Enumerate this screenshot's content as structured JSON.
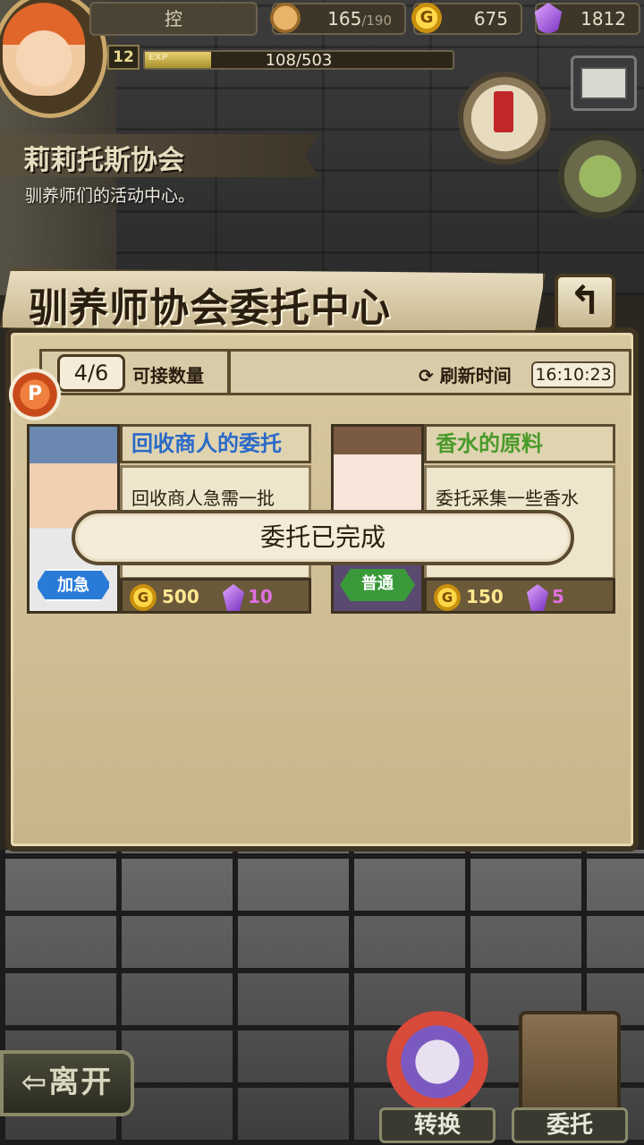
{
  "player": {
    "name": "控",
    "level": "12",
    "exp_tag": "EXP",
    "exp_text": "108/503",
    "exp_fraction": 0.215
  },
  "resources": {
    "stamina_value": "165",
    "stamina_max": "/190",
    "coin_symbol": "G",
    "gold": "675",
    "gems": "1812"
  },
  "location": {
    "title": "莉莉托斯协会",
    "subtitle": "驯养师们的活动中心。"
  },
  "panel": {
    "title": "驯养师协会委托中心",
    "back_symbol": "↰",
    "count": "4/6",
    "count_label": "可接数量",
    "refresh_label": "⟳ 刷新时间",
    "refresh_time": "16:10:23"
  },
  "commissions": [
    {
      "title": "回收商人的委托",
      "description": "回收商人急需一批",
      "tag": "加急",
      "gold": "500",
      "gems": "10"
    },
    {
      "title": "香水的原料",
      "description": "委托采集一些香水",
      "tag": "普通",
      "gold": "150",
      "gems": "5"
    }
  ],
  "toast": "委托已完成",
  "nav": {
    "leave": "⇦离开",
    "convert": "转换",
    "commission": "委托"
  },
  "colors": {
    "urgent_tag": "#2a7ad8",
    "normal_tag": "#3a9a3a",
    "title_blue": "#2a6ac8",
    "title_green": "#4a9a2a"
  }
}
